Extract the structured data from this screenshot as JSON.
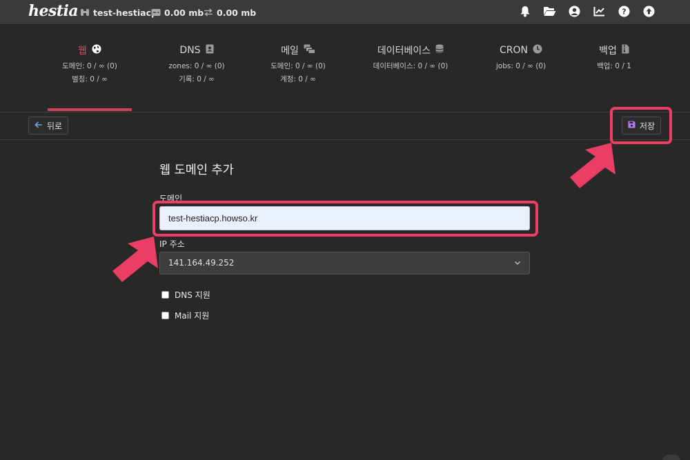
{
  "app": {
    "logo": "hestia"
  },
  "topbar": {
    "user": "test-hestiacp",
    "disk": "0.00 mb",
    "bandwidth": "0.00 mb",
    "icons": [
      "bell-icon",
      "folder-icon",
      "user-circle-icon",
      "chart-line-icon",
      "help-icon",
      "upload-icon"
    ]
  },
  "stats": [
    {
      "title": "웹",
      "icon": "globe-icon",
      "lines": [
        "도메인: 0 / ∞ (0)",
        "별칭: 0 / ∞"
      ],
      "active": true
    },
    {
      "title": "DNS",
      "icon": "address-book-icon",
      "lines": [
        "zones: 0 / ∞ (0)",
        "기록: 0 / ∞"
      ]
    },
    {
      "title": "메일",
      "icon": "mail-bulk-icon",
      "lines": [
        "도메인: 0 / ∞ (0)",
        "계정: 0 / ∞"
      ]
    },
    {
      "title": "데이터베이스",
      "icon": "database-icon",
      "lines": [
        "데이터베이스: 0 / ∞ (0)"
      ]
    },
    {
      "title": "CRON",
      "icon": "clock-icon",
      "lines": [
        "jobs: 0 / ∞ (0)"
      ]
    },
    {
      "title": "백업",
      "icon": "file-archive-icon",
      "lines": [
        "백업: 0 / 1"
      ]
    }
  ],
  "toolbar": {
    "back_label": "뒤로",
    "save_label": "저장"
  },
  "form": {
    "title": "웹 도메인 추가",
    "domain_label": "도메인",
    "domain_value": "test-hestiacp.howso.kr",
    "ip_label": "IP 주소",
    "ip_value": "141.164.49.252",
    "dns_support_label": "DNS 지원",
    "mail_support_label": "Mail 지원"
  },
  "colors": {
    "accent": "#e0475e",
    "highlight": "#ea3e64",
    "background": "#282828",
    "topbar": "#3a3a3a"
  }
}
